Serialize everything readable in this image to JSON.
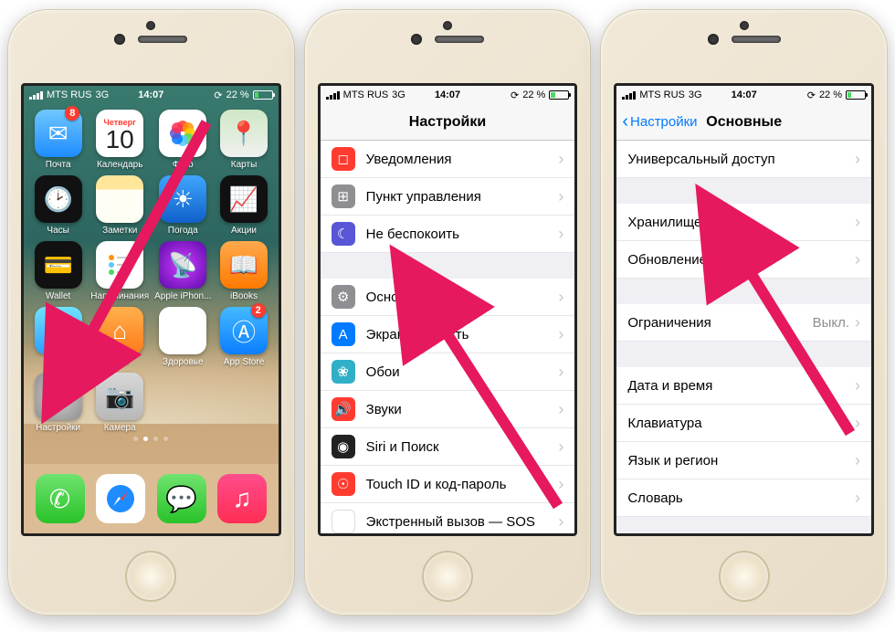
{
  "status": {
    "carrier": "MTS RUS",
    "network": "3G",
    "time": "14:07",
    "battery_pct": "22 %"
  },
  "home": {
    "calendar_dow": "Четверг",
    "calendar_day": "10",
    "apps_row1": [
      {
        "label": "Почта",
        "badge": "8"
      },
      {
        "label": "Календарь"
      },
      {
        "label": "Фото"
      },
      {
        "label": "Карты"
      }
    ],
    "apps_row2": [
      {
        "label": "Часы"
      },
      {
        "label": "Заметки"
      },
      {
        "label": "Погода"
      },
      {
        "label": "Акции"
      }
    ],
    "apps_row3": [
      {
        "label": "Wallet"
      },
      {
        "label": "Напоминания"
      },
      {
        "label": "Apple iPhon..."
      },
      {
        "label": "iBooks"
      }
    ],
    "apps_row4": [
      {
        "label": "Видео"
      },
      {
        "label": "Дом"
      },
      {
        "label": "Здоровье"
      },
      {
        "label": "App Store",
        "badge": "2"
      }
    ],
    "apps_row5": [
      {
        "label": "Настройки"
      },
      {
        "label": "Камера"
      }
    ]
  },
  "settings": {
    "title": "Настройки",
    "items_group1": [
      {
        "label": "Уведомления"
      },
      {
        "label": "Пункт управления"
      },
      {
        "label": "Не беспокоить"
      }
    ],
    "items_group2": [
      {
        "label": "Основные"
      },
      {
        "label": "Экран и яркость"
      },
      {
        "label": "Обои"
      },
      {
        "label": "Звуки"
      },
      {
        "label": "Siri и Поиск"
      },
      {
        "label": "Touch ID и код-пароль"
      },
      {
        "label": "Экстренный вызов — SOS"
      }
    ]
  },
  "general": {
    "back": "Настройки",
    "title": "Основные",
    "group1": [
      {
        "label": "Универсальный доступ"
      }
    ],
    "group2": [
      {
        "label": "Хранилище iPhone"
      },
      {
        "label": "Обновление контента"
      }
    ],
    "group3": [
      {
        "label": "Ограничения",
        "value": "Выкл."
      }
    ],
    "group4": [
      {
        "label": "Дата и время"
      },
      {
        "label": "Клавиатура"
      },
      {
        "label": "Язык и регион"
      },
      {
        "label": "Словарь"
      }
    ]
  }
}
